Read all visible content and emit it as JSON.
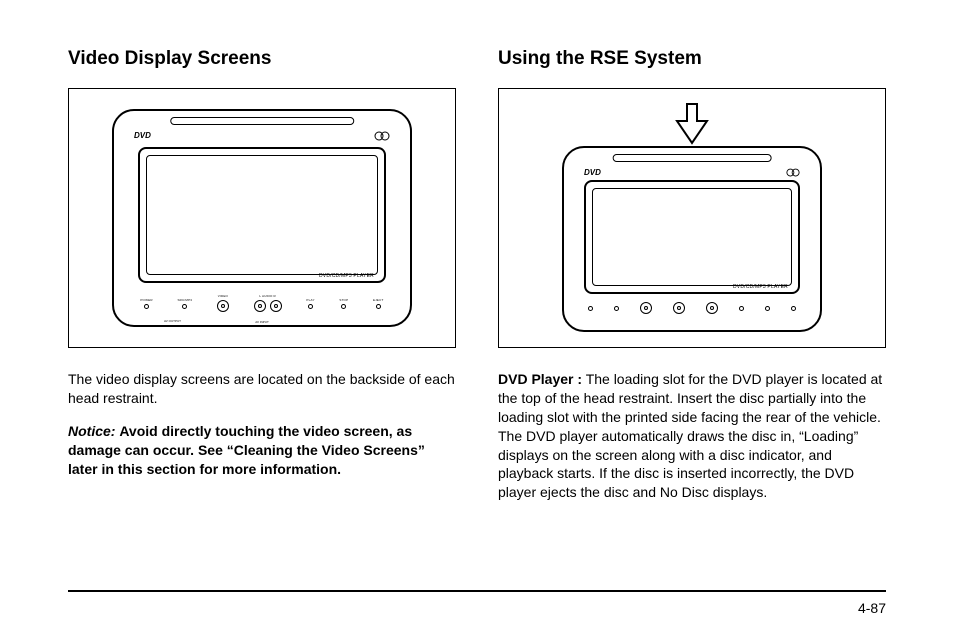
{
  "left": {
    "heading": "Video Display Screens",
    "figure": {
      "dvd_logo": "DVD",
      "cd_logo": "disc",
      "screen_label": "DVD/CD/MP3 PLAYER",
      "controls": {
        "power": "POWER",
        "source": "SRC/MP3",
        "video": "VIDEO",
        "audio": "L AUDIO R",
        "play": "PLAY",
        "stop": "STOP",
        "eject": "EJECT",
        "av": "AV OUTPUT",
        "input": "AV INPUT"
      }
    },
    "para1": "The video display screens are located on the backside of each head restraint.",
    "notice_label": "Notice:",
    "notice_body": "Avoid directly touching the video screen, as damage can occur. See “Cleaning the Video Screens” later in this section for more information."
  },
  "right": {
    "heading": "Using the RSE System",
    "figure": {
      "dvd_logo": "DVD",
      "cd_logo": "disc",
      "screen_label": "DVD/CD/MP3 PLAYER"
    },
    "label": "DVD Player :",
    "para1": "The loading slot for the DVD player is located at the top of the head restraint. Insert the disc partially into the loading slot with the printed side facing the rear of the vehicle. The DVD player automatically draws the disc in, “Loading” displays on the screen along with a disc indicator, and playback starts. If the disc is inserted incorrectly, the DVD player ejects the disc and No Disc displays."
  },
  "page_number": "4-87"
}
